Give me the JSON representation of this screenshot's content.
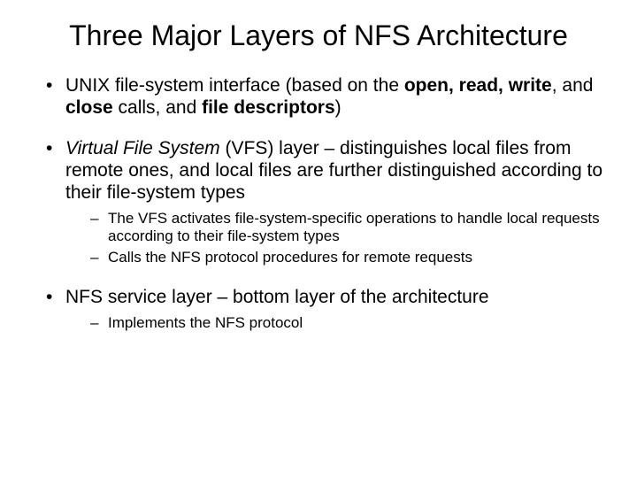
{
  "title": "Three Major Layers of NFS Architecture",
  "bullets": [
    {
      "segments": [
        {
          "t": "UNIX file-system interface (based on the "
        },
        {
          "t": "open, read, write",
          "b": true
        },
        {
          "t": ", and "
        },
        {
          "t": "close",
          "b": true
        },
        {
          "t": " calls, and "
        },
        {
          "t": "file descriptors",
          "b": true
        },
        {
          "t": ")"
        }
      ]
    },
    {
      "segments": [
        {
          "t": "Virtual File System",
          "i": true
        },
        {
          "t": " (VFS) layer – distinguishes local files from remote ones, and local files are further distinguished according to their file-system types"
        }
      ],
      "sub": [
        "The VFS activates file-system-specific operations to handle local requests according to their file-system types",
        "Calls the NFS protocol procedures for remote requests"
      ]
    },
    {
      "segments": [
        {
          "t": "NFS service layer – bottom layer of the architecture"
        }
      ],
      "sub": [
        "Implements the NFS protocol"
      ]
    }
  ]
}
